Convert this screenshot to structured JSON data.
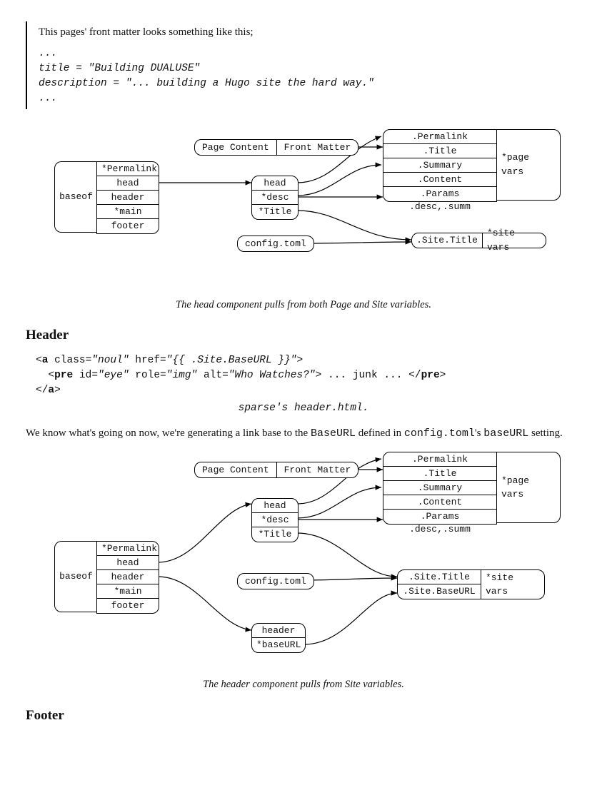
{
  "frontmatter": {
    "intro": "This pages' front matter looks something like this;",
    "code": "...\ntitle = \"Building DUALUSE\"\ndescription = \"... building a Hugo site the hard way.\"\n..."
  },
  "diagram1": {
    "baseof_label": "baseof",
    "baseof_cells": [
      "*Permalink",
      "head",
      "header",
      "*main",
      "footer"
    ],
    "pagecontent": "Page Content",
    "frontmatter": "Front Matter",
    "head_cells": [
      "head",
      "*desc",
      "*Title"
    ],
    "config": "config.toml",
    "pagevars_cells": [
      ".Permalink",
      ".Title",
      ".Summary",
      ".Content",
      ".Params .desc,.summ"
    ],
    "pagevars_label": "*page vars",
    "site_cells": [
      ".Site.Title"
    ],
    "sitevars_label": "*site vars",
    "caption": "The head component pulls from both Page and Site variables."
  },
  "header_section": {
    "title": "Header",
    "code_l1_a": "<",
    "code_l1_b": "a",
    "code_l1_c": " class=",
    "code_l1_d": "\"noul\"",
    "code_l1_e": " href=",
    "code_l1_f": "\"{{ .Site.BaseURL }}\"",
    "code_l1_g": ">",
    "code_l2_a": "  <",
    "code_l2_b": "pre",
    "code_l2_c": " id=",
    "code_l2_d": "\"eye\"",
    "code_l2_e": " role=",
    "code_l2_f": "\"img\"",
    "code_l2_g": " alt=",
    "code_l2_h": "\"Who Watches?\"",
    "code_l2_i": "> ... junk ... </",
    "code_l2_j": "pre",
    "code_l2_k": ">",
    "code_l3_a": "</",
    "code_l3_b": "a",
    "code_l3_c": ">",
    "code_caption": "sparse's header.html.",
    "para_a": "We know what's going on now, we're generating a link base to the ",
    "para_b": "BaseURL",
    "para_c": " defined in ",
    "para_d": "config.toml",
    "para_e": "'s ",
    "para_f": "baseURL",
    "para_g": " setting."
  },
  "diagram2": {
    "baseof_label": "baseof",
    "baseof_cells": [
      "*Permalink",
      "head",
      "header",
      "*main",
      "footer"
    ],
    "pagecontent": "Page Content",
    "frontmatter": "Front Matter",
    "head_cells": [
      "head",
      "*desc",
      "*Title"
    ],
    "config": "config.toml",
    "header_cells": [
      "header",
      "*baseURL"
    ],
    "pagevars_cells": [
      ".Permalink",
      ".Title",
      ".Summary",
      ".Content",
      ".Params .desc,.summ"
    ],
    "pagevars_label": "*page vars",
    "site_cells": [
      ".Site.Title",
      ".Site.BaseURL"
    ],
    "sitevars_label": "*site vars",
    "caption": "The header component pulls from Site variables."
  },
  "footer_section": {
    "title": "Footer"
  }
}
